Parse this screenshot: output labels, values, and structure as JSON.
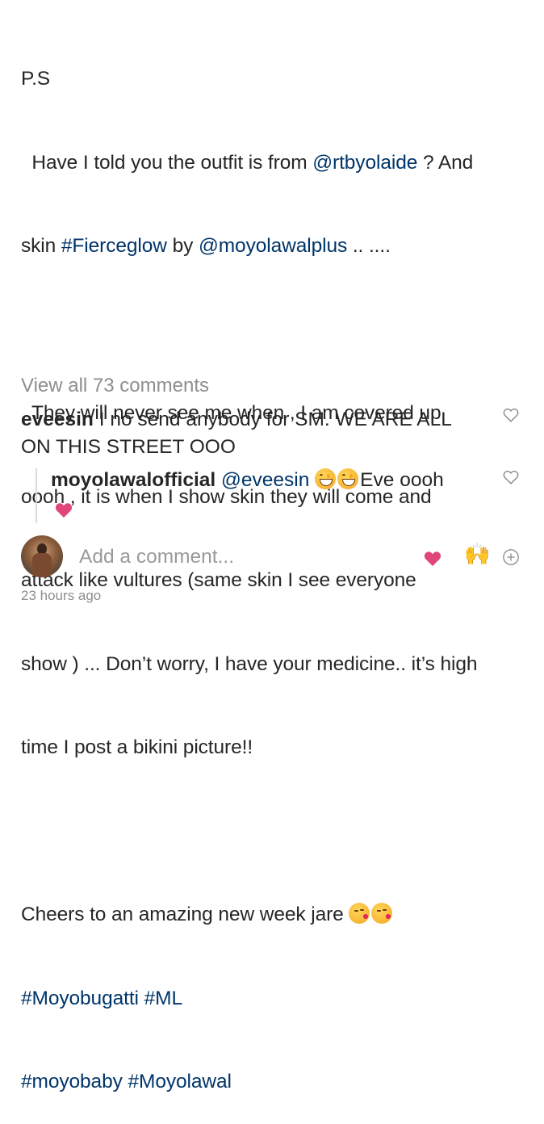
{
  "caption": {
    "line1": "P.S",
    "line2_pre": "  Have I told you the outfit is from ",
    "line2_link": "@rtbyolaide",
    "line2_post": " ? And",
    "line3_pre": "skin ",
    "line3_tag": "#Fierceglow",
    "line3_mid": " by ",
    "line3_link": "@moyolawalplus",
    "line3_post": " .. ....",
    "line5": "  They will never see me when , I am covered up",
    "line6": "oooh , it is when I show skin they will come and",
    "line7": "attack like vultures (same skin I see everyone",
    "line8": "show ) ... Don’t worry, I have your medicine.. it’s high",
    "line9": "time I post a bikini picture!!",
    "line11": "Cheers to an amazing new week jare ",
    "tag1": "#Moyobugatti",
    "tag2": "#ML",
    "tag3": "#moyobaby",
    "tag4": "#Moyolawal"
  },
  "comments": {
    "view_all": "View all 73 comments",
    "first": {
      "username": "eveesin",
      "text_line1": " I no send anybody for SM. WE ARE ALL",
      "text_line2": "ON THIS STREET OOO"
    },
    "reply": {
      "username": "moyolawalofficial",
      "mention": "@eveesin",
      "text": "Eve oooh"
    }
  },
  "composer": {
    "placeholder": "Add a comment...",
    "quick_reaction": "🙌"
  },
  "timestamp": "23 hours ago",
  "icons": {
    "like_outline": "heart-outline-icon",
    "like_filled": "heart-filled-icon",
    "add": "plus-circle-icon",
    "emoji_kiss": "face-blowing-kiss-emoji",
    "emoji_laugh": "grinning-squinting-face-emoji"
  },
  "colors": {
    "link": "#003569",
    "muted": "#8e8e8e",
    "heart": "#ed4956"
  }
}
